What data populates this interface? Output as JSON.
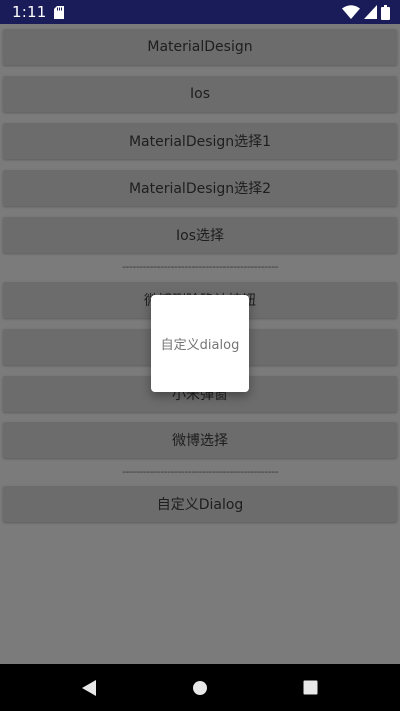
{
  "statusbar": {
    "time": "1:11",
    "icons": [
      "sd-card-icon",
      "wifi-icon",
      "signal-icon",
      "battery-icon"
    ]
  },
  "buttons": [
    {
      "label": "MaterialDesign"
    },
    {
      "label": "Ios"
    },
    {
      "label": "MaterialDesign选择1"
    },
    {
      "label": "MaterialDesign选择2"
    },
    {
      "label": "Ios选择"
    },
    {
      "label": "微博删除确认按钮"
    },
    {
      "label": ""
    },
    {
      "label": "小米弹窗"
    },
    {
      "label": "微博选择"
    },
    {
      "label": "自定义Dialog"
    }
  ],
  "dividers": [
    "---------------------------------------------",
    "---------------------------------------------"
  ],
  "dialog": {
    "text": "自定义dialog"
  },
  "navbar": {
    "icons": [
      "back-icon",
      "home-icon",
      "recents-icon"
    ]
  }
}
